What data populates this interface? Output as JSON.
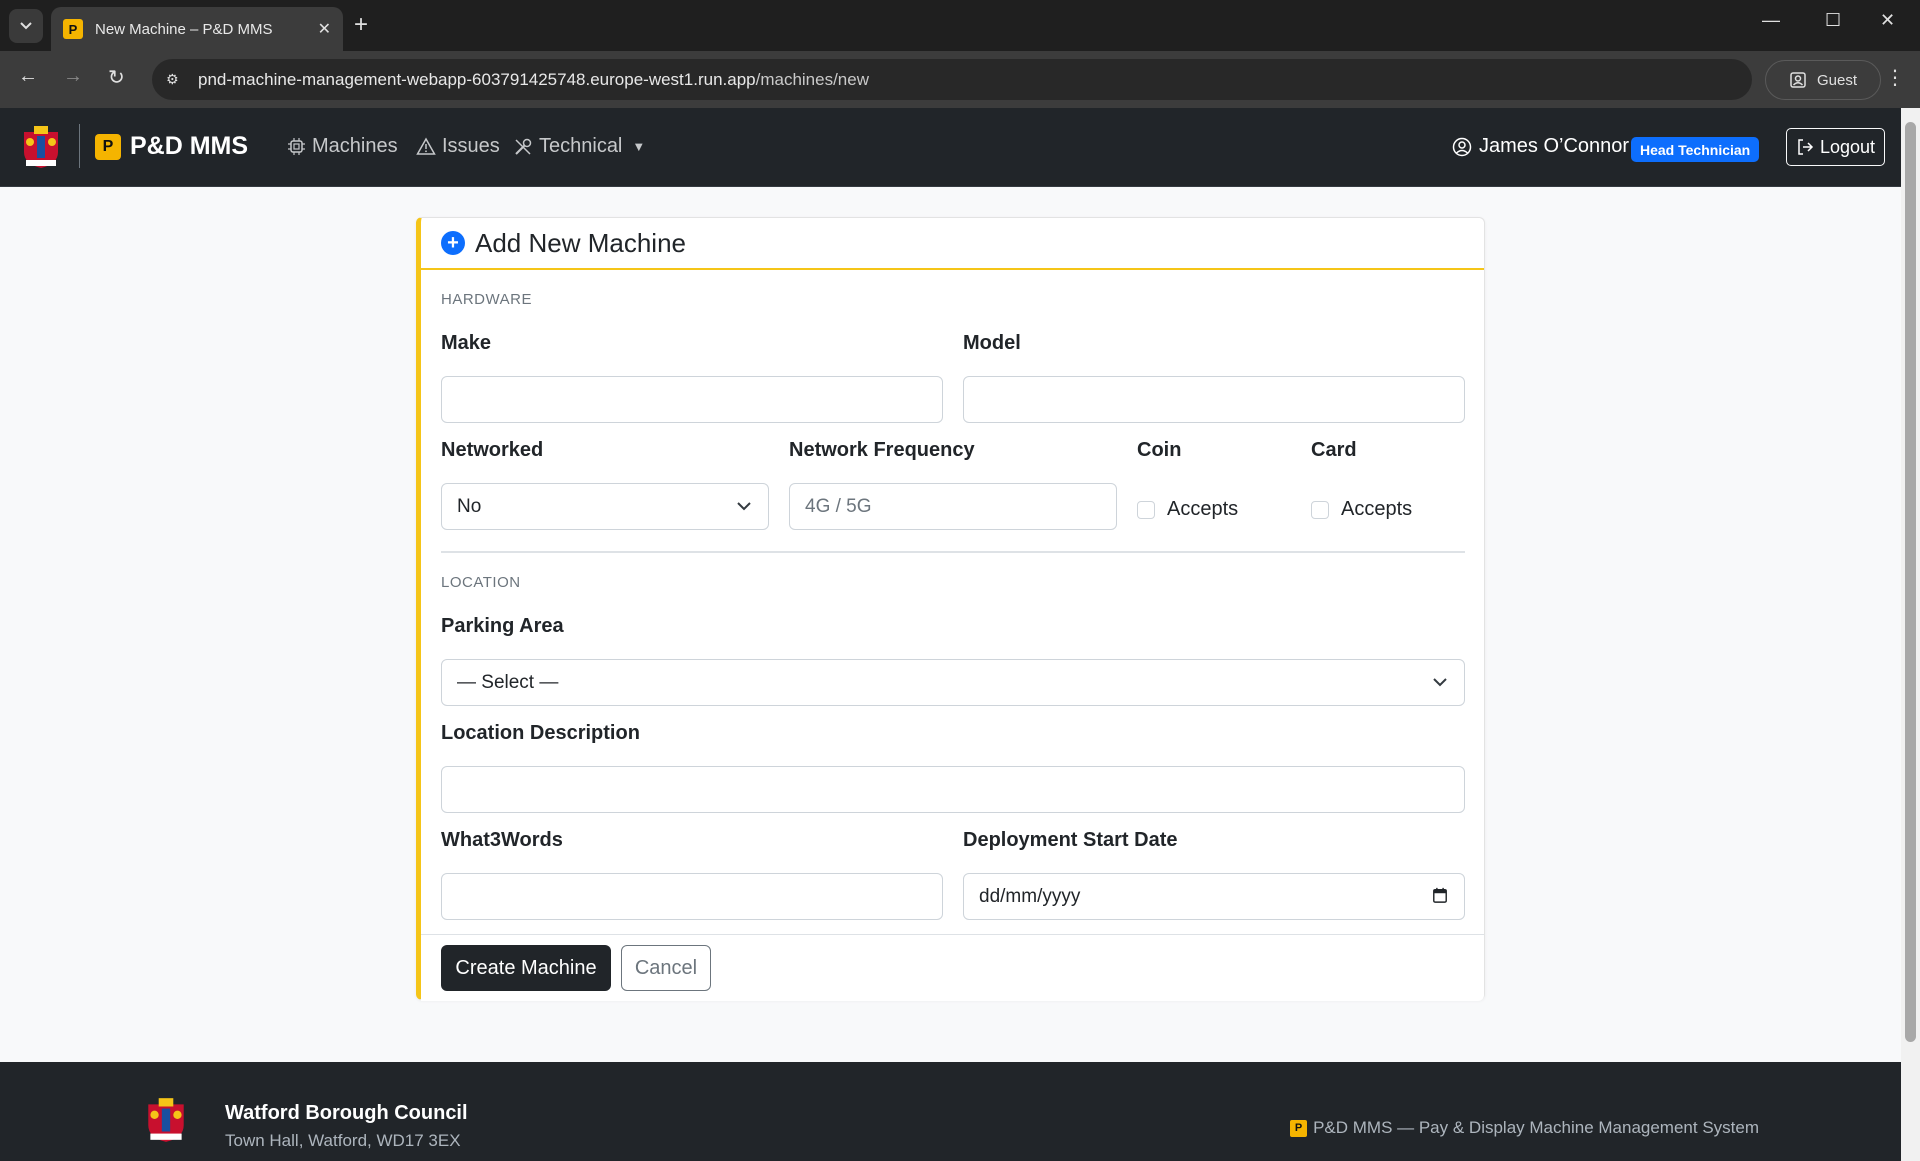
{
  "browser": {
    "tab_title": "New Machine – P&D MMS",
    "tab_favicon": "P",
    "url_host": "pnd-machine-management-webapp-603791425748.europe-west1.run.app",
    "url_path": "/machines/new",
    "profile_label": "Guest"
  },
  "nav": {
    "brand_icon": "P",
    "brand_name": "P&D MMS",
    "links": [
      {
        "label": "Machines",
        "icon": "cpu-icon"
      },
      {
        "label": "Issues",
        "icon": "warning-icon"
      },
      {
        "label": "Technical",
        "icon": "tools-icon"
      }
    ],
    "user_name": "James O’Connor",
    "role": "Head Technician",
    "logout_label": "Logout"
  },
  "form": {
    "title": "Add New Machine",
    "hardware_section": "HARDWARE",
    "make_label": "Make",
    "make_value": "",
    "model_label": "Model",
    "model_value": "",
    "networked_label": "Networked",
    "networked_value": "No",
    "network_frequency_label": "Network Frequency",
    "network_frequency_placeholder": "4G / 5G",
    "coin_label": "Coin",
    "coin_checkbox_label": "Accepts",
    "card_label": "Card",
    "card_checkbox_label": "Accepts",
    "location_section": "LOCATION",
    "parking_area_label": "Parking Area",
    "parking_area_value": "— Select —",
    "location_description_label": "Location Description",
    "location_description_value": "",
    "what3words_label": "What3Words",
    "what3words_value": "",
    "deployment_start_label": "Deployment Start Date",
    "deployment_start_placeholder": "dd/mm/yyyy",
    "create_button": "Create Machine",
    "cancel_button": "Cancel"
  },
  "footer": {
    "org_name": "Watford Borough Council",
    "org_address": "Town Hall, Watford, WD17 3EX",
    "badge": "P",
    "tagline": "P&D MMS — Pay & Display Machine Management System"
  },
  "colors": {
    "accent_yellow": "#f5c518",
    "brand_yellow": "#f5b400",
    "primary_blue": "#0d6efd",
    "dark": "#212529"
  }
}
